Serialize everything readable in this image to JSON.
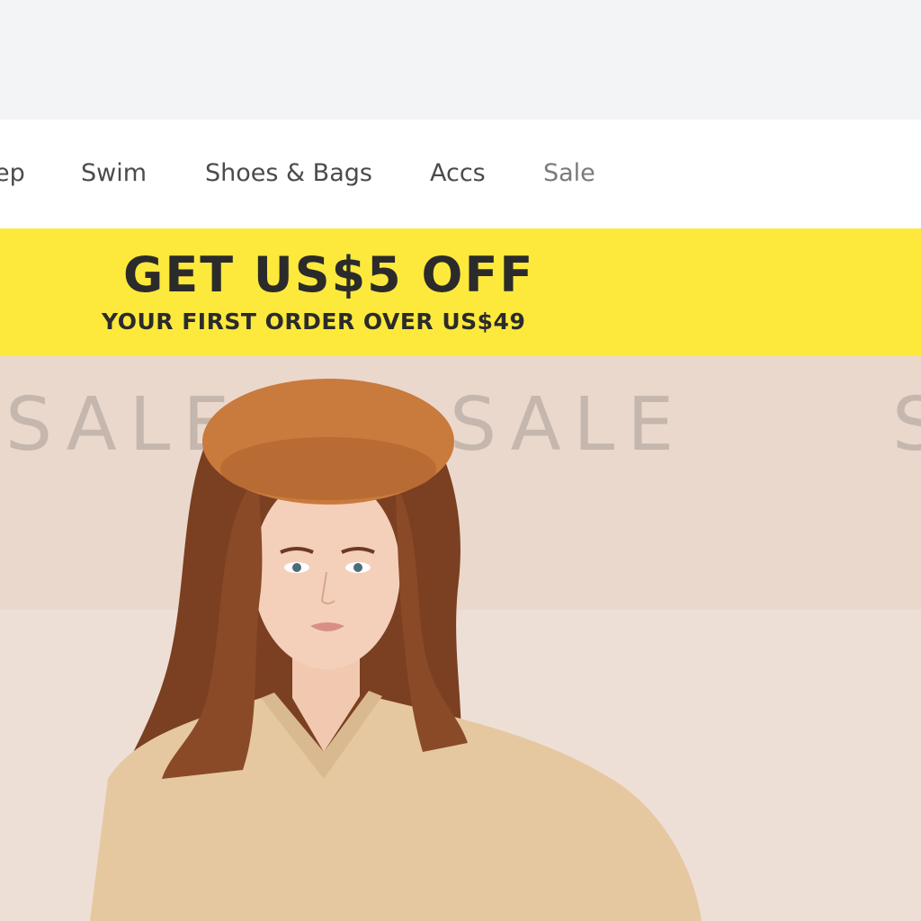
{
  "nav": {
    "items": [
      {
        "label": "ep"
      },
      {
        "label": "Swim"
      },
      {
        "label": "Shoes & Bags"
      },
      {
        "label": "Accs"
      },
      {
        "label": "Sale"
      }
    ]
  },
  "promo": {
    "headline": "GET US$5 OFF",
    "subline": "YOUR FIRST ORDER OVER US$49"
  },
  "hero": {
    "background_words": [
      "SALE",
      "SALE",
      "S"
    ]
  },
  "colors": {
    "promo_bg": "#fde93b",
    "hero_bg": "#eedfd6",
    "nav_text": "#4b4b4b"
  }
}
